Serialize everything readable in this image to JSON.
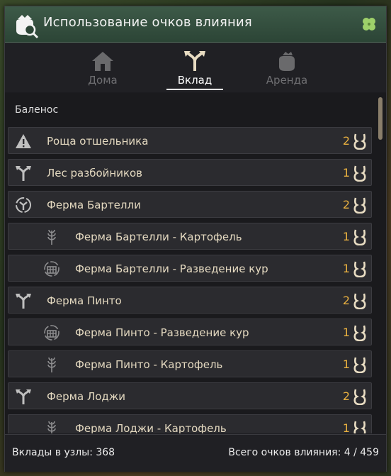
{
  "window": {
    "title": "Использование очков влияния"
  },
  "tabs": [
    {
      "label": "Дома",
      "icon": "house-icon",
      "active": false
    },
    {
      "label": "Вклад",
      "icon": "branch-arrows-icon",
      "active": true
    },
    {
      "label": "Аренда",
      "icon": "money-bag-icon",
      "active": false
    }
  ],
  "region": "Баленос",
  "nodes": [
    {
      "label": "Роща отшельника",
      "count": "2",
      "icon": "warning-triangle-icon",
      "child": false
    },
    {
      "label": "Лес разбойников",
      "count": "1",
      "icon": "branch-arrows-icon",
      "child": false
    },
    {
      "label": "Ферма Бартелли",
      "count": "2",
      "icon": "hub-circle-icon",
      "child": false
    },
    {
      "label": "Ферма Бартелли - Картофель",
      "count": "1",
      "icon": "wheat-icon",
      "child": true
    },
    {
      "label": "Ферма Бартелли - Разведение кур",
      "count": "1",
      "icon": "farm-coop-icon",
      "child": true
    },
    {
      "label": "Ферма Пинто",
      "count": "2",
      "icon": "branch-arrows-icon",
      "child": false
    },
    {
      "label": "Ферма Пинто - Разведение кур",
      "count": "1",
      "icon": "farm-coop-icon",
      "child": true
    },
    {
      "label": "Ферма Пинто - Картофель",
      "count": "1",
      "icon": "wheat-icon",
      "child": true
    },
    {
      "label": "Ферма Лоджи",
      "count": "2",
      "icon": "branch-arrows-icon",
      "child": false
    },
    {
      "label": "Ферма Лоджи - Картофель",
      "count": "1",
      "icon": "wheat-icon",
      "child": true
    }
  ],
  "footer": {
    "investments": "Вклады в узлы: 368",
    "total_points": "Всего очков влияния: 4 / 459"
  },
  "colors": {
    "accent_gold": "#e8b040",
    "title_green": "#3d5a48",
    "row_bg": "#2b2b2f"
  }
}
